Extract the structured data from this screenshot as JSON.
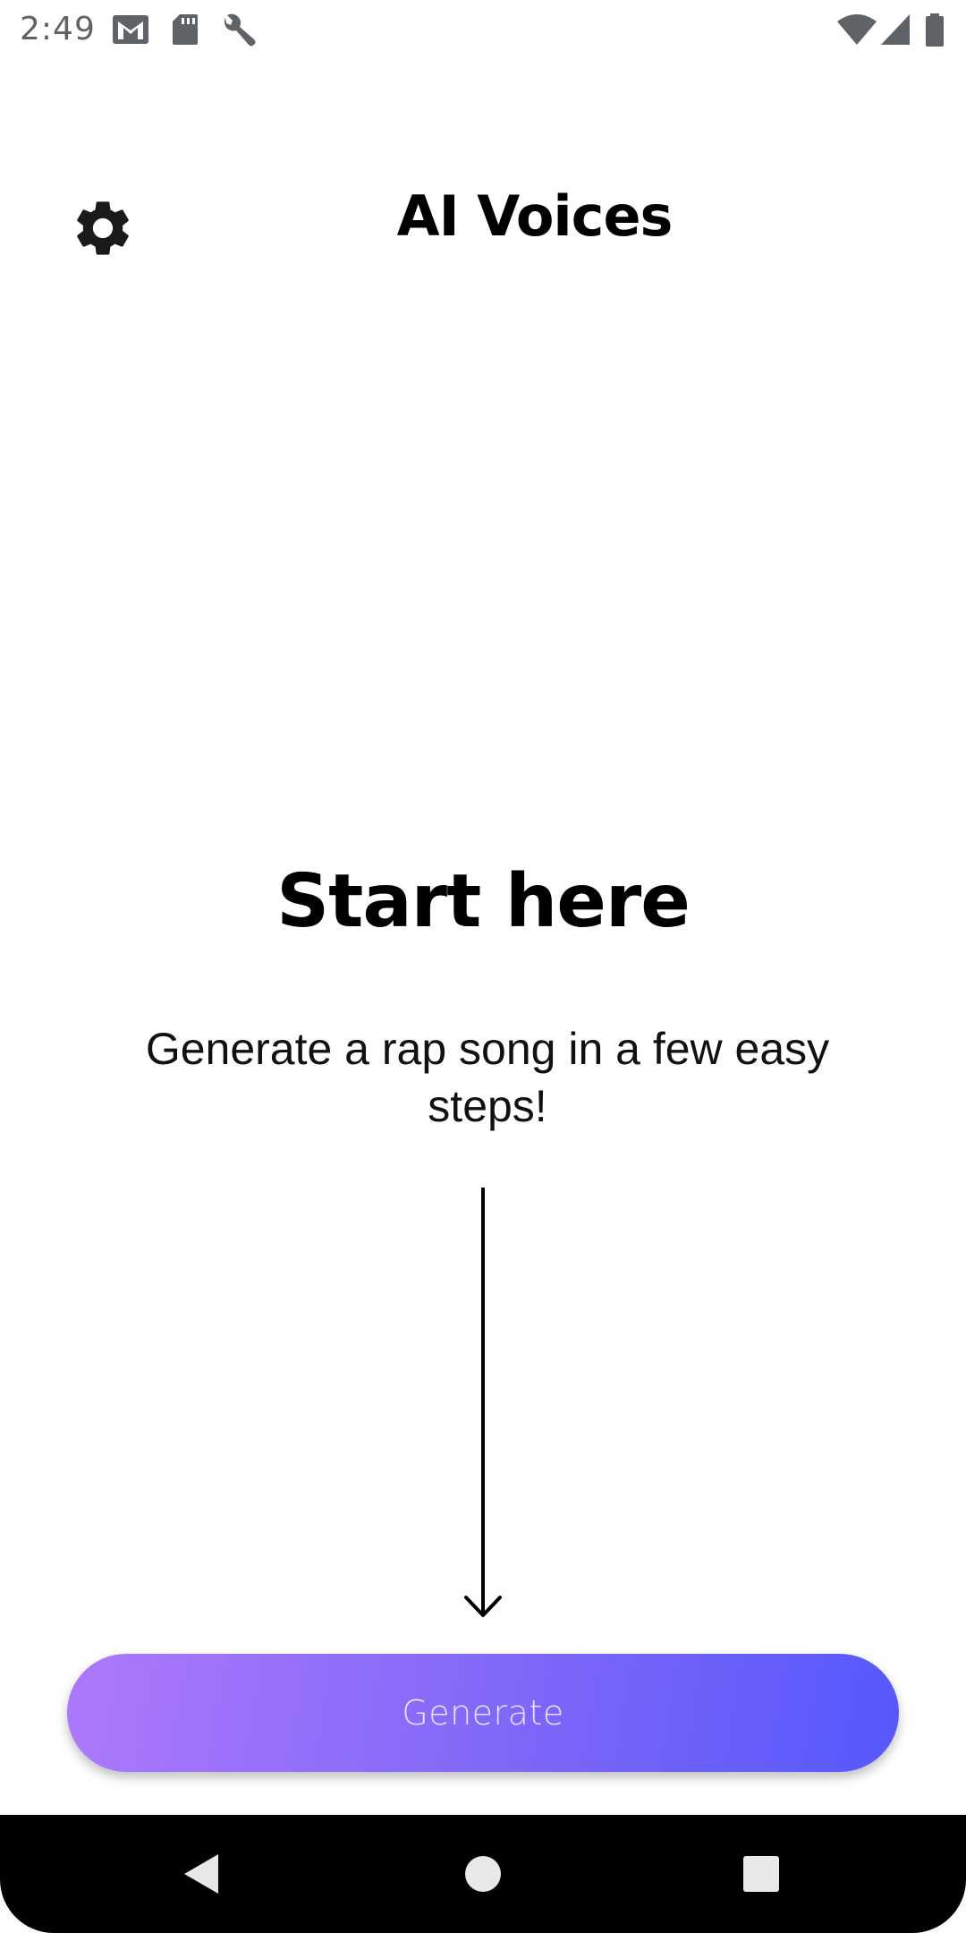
{
  "status_bar": {
    "time": "2:49",
    "icons": [
      "gmail-icon",
      "sd-card-icon",
      "wrench-icon",
      "wifi-icon",
      "cell-signal-icon",
      "battery-icon"
    ]
  },
  "app_bar": {
    "title": "AI Voices",
    "settings_icon": "gear-icon"
  },
  "hero": {
    "heading": "Start here",
    "subtitle": "Generate a rap song in a few easy steps!",
    "arrow_icon": "arrow-down-icon"
  },
  "generate_button": {
    "label": "Generate",
    "gradient_start": "#ad79fb",
    "gradient_end": "#5658fc"
  },
  "nav_bar": {
    "buttons": [
      "back-icon",
      "home-icon",
      "recents-icon"
    ]
  }
}
